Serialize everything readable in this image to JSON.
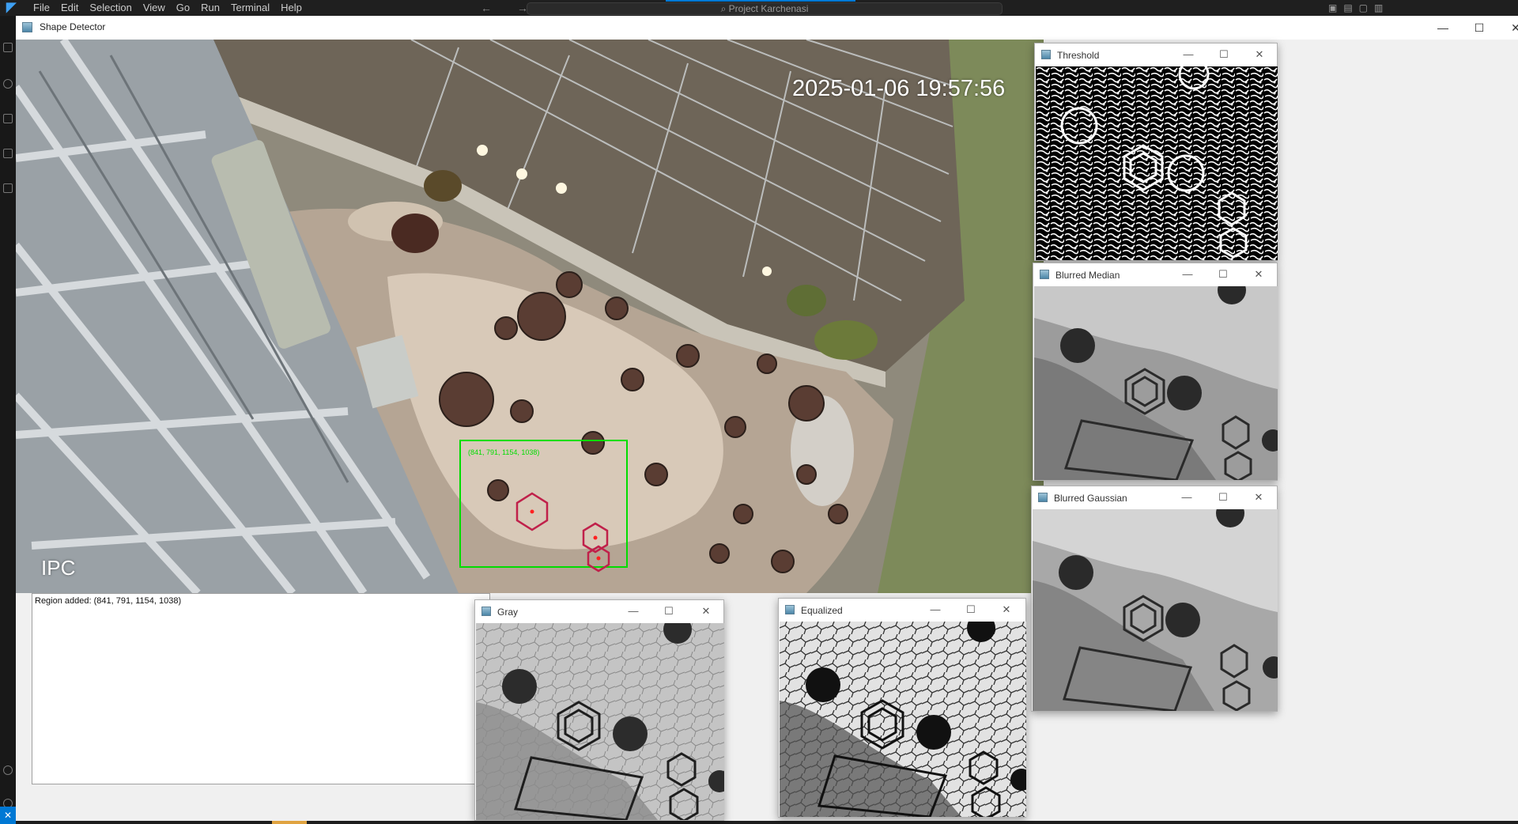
{
  "vscode": {
    "logo": "◤",
    "menu": [
      "File",
      "Edit",
      "Selection",
      "View",
      "Go",
      "Run",
      "Terminal",
      "Help"
    ],
    "search_text": "Project Karchenasi",
    "nav_arrows": "← →",
    "statusbar_icon": "✕"
  },
  "main_window": {
    "title": "Shape Detector",
    "controls": {
      "minimize": "—",
      "maximize": "☐",
      "close": "✕"
    }
  },
  "camera": {
    "timestamp": "2025-01-06 19:57:56",
    "overlay_label": "IPC",
    "roi_label": "(841, 791, 1154, 1038)",
    "roi_color": "#00dd00",
    "shape_color": "#c0204a"
  },
  "log": {
    "lines": [
      "Region added: (841, 791, 1154, 1038)"
    ]
  },
  "windows": {
    "threshold": {
      "title": "Threshold"
    },
    "blurred_median": {
      "title": "Blurred Median"
    },
    "blurred_gaussian": {
      "title": "Blurred Gaussian"
    },
    "gray": {
      "title": "Gray"
    },
    "equalized": {
      "title": "Equalized"
    }
  },
  "window_controls": {
    "minimize": "—",
    "maximize": "☐",
    "close": "✕"
  }
}
